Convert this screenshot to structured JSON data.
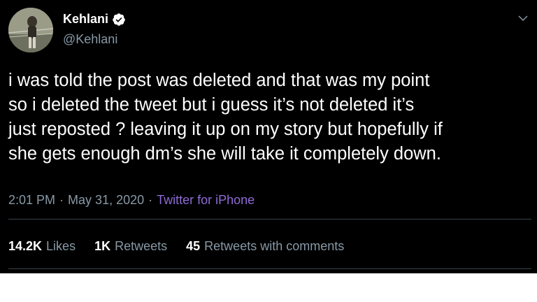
{
  "author": {
    "display_name": "Kehlani",
    "handle": "@Kehlani",
    "avatar_icon": "profile-photo",
    "verified_icon": "verified-badge-icon",
    "verified_color": "#ffffff"
  },
  "tweet": {
    "text": "i was told the post was deleted and that was my point\nso i deleted the tweet but i guess it’s not deleted it’s\njust reposted ? leaving it up on my story but hopefully if\nshe gets enough dm’s she will take it completely down.",
    "time": "2:01 PM",
    "separator": "·",
    "date": "May 31, 2020",
    "source": "Twitter for iPhone"
  },
  "stats": {
    "likes_count": "14.2K",
    "likes_label": "Likes",
    "retweets_count": "1K",
    "retweets_label": "Retweets",
    "quotes_count": "45",
    "quotes_label": "Retweets with comments"
  },
  "menu_icon": "chevron-down-icon",
  "colors": {
    "background": "#000000",
    "text": "#ffffff",
    "muted": "#8899a6",
    "source_link": "#8f6bd6",
    "divider": "#38444d"
  }
}
